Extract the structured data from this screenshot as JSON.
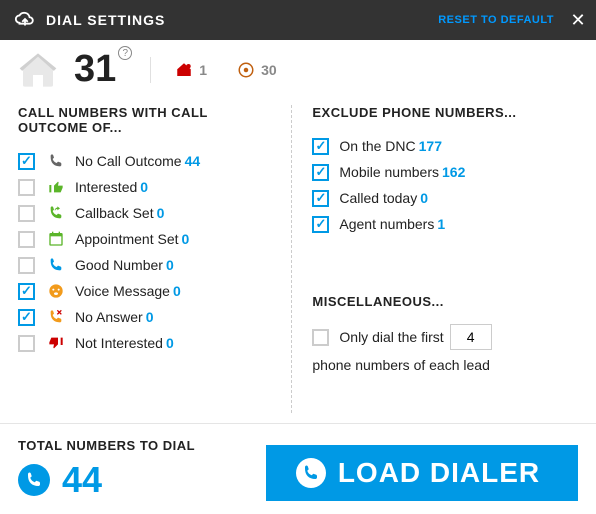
{
  "header": {
    "title": "DIAL SETTINGS",
    "reset": "RESET TO DEFAULT"
  },
  "summary": {
    "total": "31",
    "stat1": "1",
    "stat2": "30"
  },
  "left": {
    "title": "CALL NUMBERS WITH CALL OUTCOME OF...",
    "items": [
      {
        "label": "No Call Outcome",
        "count": "44",
        "checked": true,
        "icon": "phone",
        "color": "#666"
      },
      {
        "label": "Interested",
        "count": "0",
        "checked": false,
        "icon": "thumb-up",
        "color": "#5bb52a"
      },
      {
        "label": "Callback Set",
        "count": "0",
        "checked": false,
        "icon": "phone-back",
        "color": "#5bb52a"
      },
      {
        "label": "Appointment Set",
        "count": "0",
        "checked": false,
        "icon": "calendar",
        "color": "#5bb52a"
      },
      {
        "label": "Good Number",
        "count": "0",
        "checked": false,
        "icon": "phone",
        "color": "#0099e5"
      },
      {
        "label": "Voice Message",
        "count": "0",
        "checked": true,
        "icon": "face",
        "color": "#f29b1c"
      },
      {
        "label": "No Answer",
        "count": "0",
        "checked": true,
        "icon": "phone-x",
        "color": "#f29b1c"
      },
      {
        "label": "Not Interested",
        "count": "0",
        "checked": false,
        "icon": "thumb-down",
        "color": "#cc0000"
      }
    ]
  },
  "right": {
    "title": "EXCLUDE PHONE NUMBERS...",
    "items": [
      {
        "label": "On the DNC",
        "count": "177",
        "checked": true
      },
      {
        "label": "Mobile numbers",
        "count": "162",
        "checked": true
      },
      {
        "label": "Called today",
        "count": "0",
        "checked": true
      },
      {
        "label": "Agent numbers",
        "count": "1",
        "checked": true
      }
    ],
    "misc_title": "MISCELLANEOUS...",
    "misc_pre": "Only dial the first",
    "misc_val": "4",
    "misc_post": "phone numbers of each lead"
  },
  "footer": {
    "total_label": "TOTAL NUMBERS TO DIAL",
    "total": "44",
    "button": "LOAD DIALER"
  }
}
